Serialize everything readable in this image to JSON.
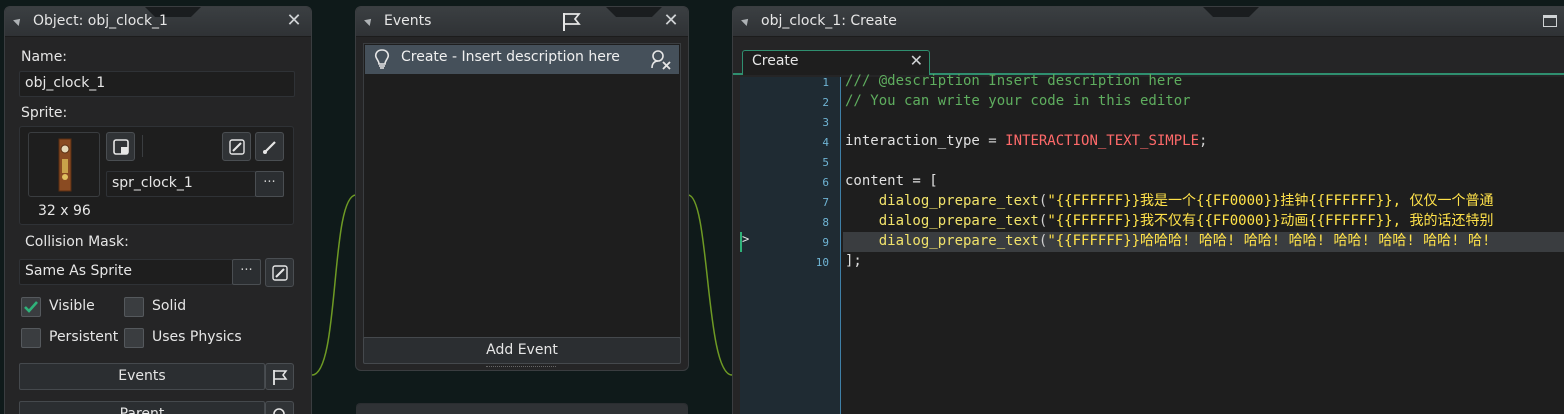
{
  "object_panel": {
    "title": "Object: obj_clock_1",
    "name_label": "Name:",
    "name_value": "obj_clock_1",
    "sprite_label": "Sprite:",
    "sprite_value": "spr_clock_1",
    "sprite_size": "32 x 96",
    "collision_label": "Collision Mask:",
    "collision_value": "Same As Sprite",
    "checkboxes": {
      "visible": {
        "label": "Visible",
        "checked": true
      },
      "solid": {
        "label": "Solid",
        "checked": false
      },
      "persistent": {
        "label": "Persistent",
        "checked": false
      },
      "uses_physics": {
        "label": "Uses Physics",
        "checked": false
      }
    },
    "events_button": "Events",
    "parent_button": "Parent",
    "dots": "···"
  },
  "events_panel": {
    "title": "Events",
    "event_item": "Create - Insert description here",
    "add_event_button": "Add Event"
  },
  "code_panel": {
    "title": "obj_clock_1: Create",
    "tab_label": "Create",
    "line_numbers": [
      "1",
      "2",
      "3",
      "4",
      "5",
      "6",
      "7",
      "8",
      "9",
      "10"
    ],
    "lines": {
      "l1": "/// @description Insert description here",
      "l2": "// You can write your code in this editor",
      "l4_var": "interaction_type",
      "l4_op": " = ",
      "l4_const": "INTERACTION_TEXT_SIMPLE",
      "l4_end": ";",
      "l6": "content = [",
      "indent": "    ",
      "fn": "dialog_prepare_text",
      "paren": "(",
      "l7_str": "\"{{FFFFFF}}我是一个{{FF0000}}挂钟{{FFFFFF}}, 仅仅一个普通",
      "l8_str": "\"{{FFFFFF}}我不仅有{{FF0000}}动画{{FFFFFF}}, 我的话还特别",
      "l9_str": "\"{{FFFFFF}}哈哈哈! 哈哈! 哈哈! 哈哈! 哈哈! 哈哈! 哈哈! 哈!",
      "l10": "];"
    }
  },
  "colors": {
    "accent": "#2f8f6f",
    "wire": "#7fae2a"
  }
}
